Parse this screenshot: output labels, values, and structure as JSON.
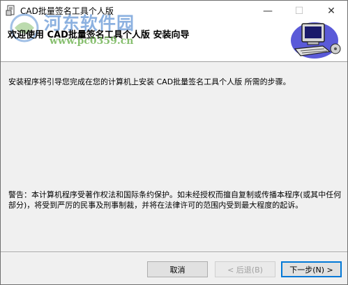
{
  "window": {
    "title": "CAD批量签名工具个人版",
    "controls": {
      "minimize": "—",
      "maximize": "☐",
      "close": "✕"
    }
  },
  "header": {
    "title": "欢迎使用 CAD批量签名工具个人版 安装向导",
    "watermark_name": "河东软件园",
    "watermark_url": "www.pc0359.cn"
  },
  "content": {
    "intro": "安装程序将引导您完成在您的计算机上安装 CAD批量签名工具个人版 所需的步骤。",
    "warning": "警告：本计算机程序受著作权法和国际条约保护。如未经授权而擅自复制或传播本程序(或其中任何部分)，将受到严厉的民事及刑事制裁，并将在法律许可的范围内受到最大程度的起诉。"
  },
  "buttons": {
    "cancel": "取消",
    "back": "< 后退(B)",
    "next": "下一步(N) >"
  }
}
